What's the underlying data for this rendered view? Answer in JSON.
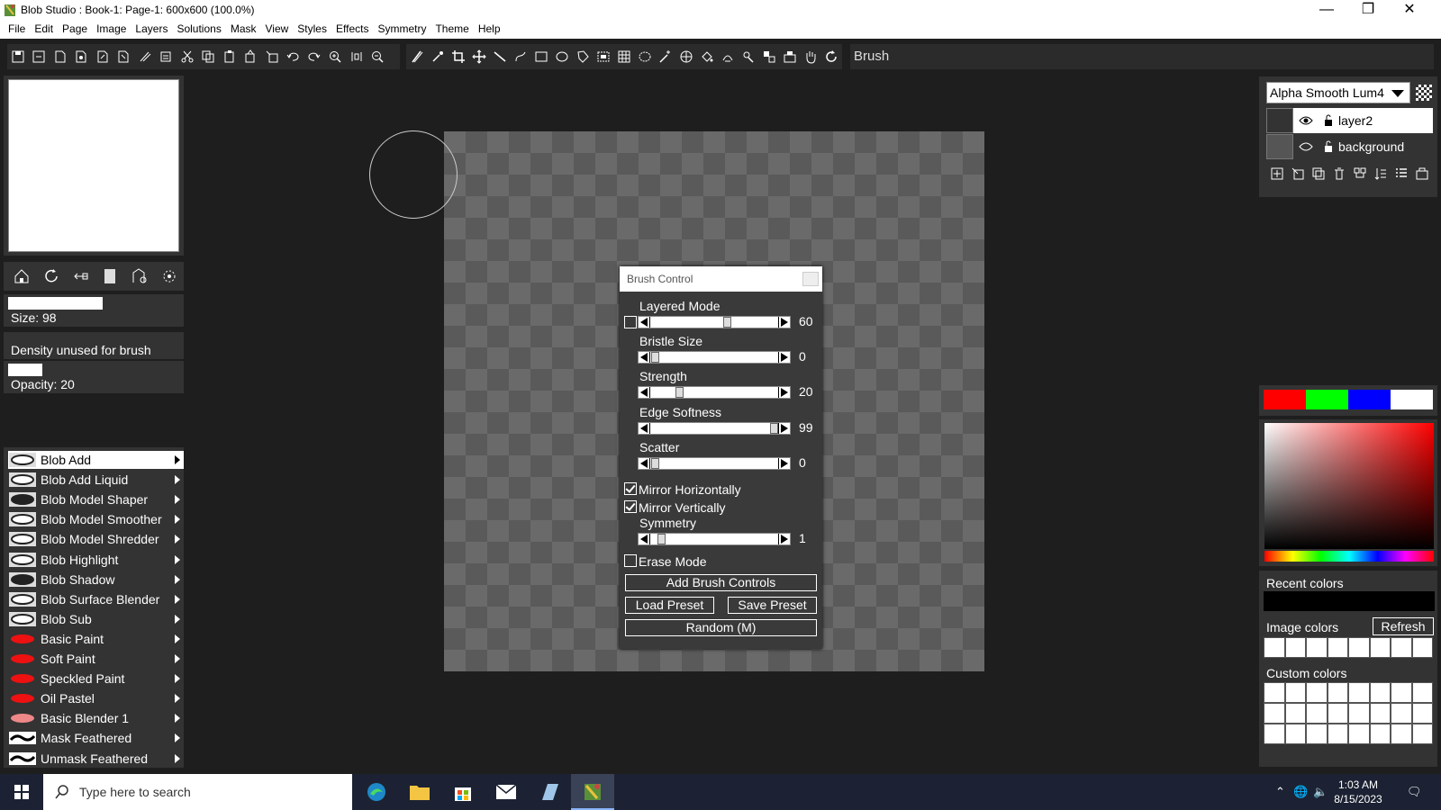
{
  "window": {
    "title": "Blob Studio : Book-1: Page-1: 600x600  (100.0%)"
  },
  "menu": [
    "File",
    "Edit",
    "Page",
    "Image",
    "Layers",
    "Solutions",
    "Mask",
    "View",
    "Styles",
    "Effects",
    "Symmetry",
    "Theme",
    "Help"
  ],
  "toolbar": {
    "current_tool": "Brush"
  },
  "left_panel": {
    "size_label": "Size: 98",
    "size_fraction": 0.55,
    "density_label": "Density unused for brush",
    "opacity_label": "Opacity: 20",
    "opacity_fraction": 0.2
  },
  "brushes": [
    {
      "label": "Blob Add",
      "selected": true
    },
    {
      "label": "Blob Add Liquid"
    },
    {
      "label": "Blob Model Shaper"
    },
    {
      "label": "Blob Model Smoother"
    },
    {
      "label": "Blob Model Shredder"
    },
    {
      "label": "Blob Highlight"
    },
    {
      "label": "Blob Shadow"
    },
    {
      "label": "Blob Surface Blender"
    },
    {
      "label": "Blob Sub"
    },
    {
      "label": "Basic Paint"
    },
    {
      "label": "Soft Paint"
    },
    {
      "label": "Speckled Paint"
    },
    {
      "label": "Oil Pastel"
    },
    {
      "label": "Basic Blender 1"
    },
    {
      "label": "Mask Feathered"
    },
    {
      "label": "Unmask Feathered"
    }
  ],
  "brush_control": {
    "title": "Brush Control",
    "sliders": [
      {
        "label": "Layered Mode",
        "value": "60",
        "fraction": 0.6
      },
      {
        "label": "Bristle Size",
        "value": "0",
        "fraction": 0
      },
      {
        "label": "Strength",
        "value": "20",
        "fraction": 0.2
      },
      {
        "label": "Edge Softness",
        "value": "99",
        "fraction": 0.99
      },
      {
        "label": "Scatter",
        "value": "0",
        "fraction": 0
      }
    ],
    "mirror_h": {
      "label": "Mirror Horizontally",
      "checked": true
    },
    "mirror_v": {
      "label": "Mirror Vertically",
      "checked": true
    },
    "symmetry": {
      "label": "Symmetry",
      "value": "1",
      "fraction": 0.05
    },
    "erase_mode": {
      "label": "Erase Mode",
      "checked": false
    },
    "add_controls": "Add Brush Controls",
    "load_preset": "Load Preset",
    "save_preset": "Save Preset",
    "random": "Random (M)"
  },
  "layers": {
    "blend_mode": "Alpha Smooth Lum4",
    "items": [
      {
        "name": "layer2",
        "selected": true,
        "visible": true
      },
      {
        "name": "background",
        "selected": false,
        "visible": false
      }
    ]
  },
  "swatches": [
    "#ff0000",
    "#00ff00",
    "#0000ff",
    "#ffffff"
  ],
  "colors": {
    "recent_label": "Recent colors",
    "image_label": "Image colors",
    "refresh": "Refresh",
    "custom_label": "Custom colors"
  },
  "taskbar": {
    "search_placeholder": "Type here to search",
    "time": "1:03 AM",
    "date": "8/15/2023"
  }
}
